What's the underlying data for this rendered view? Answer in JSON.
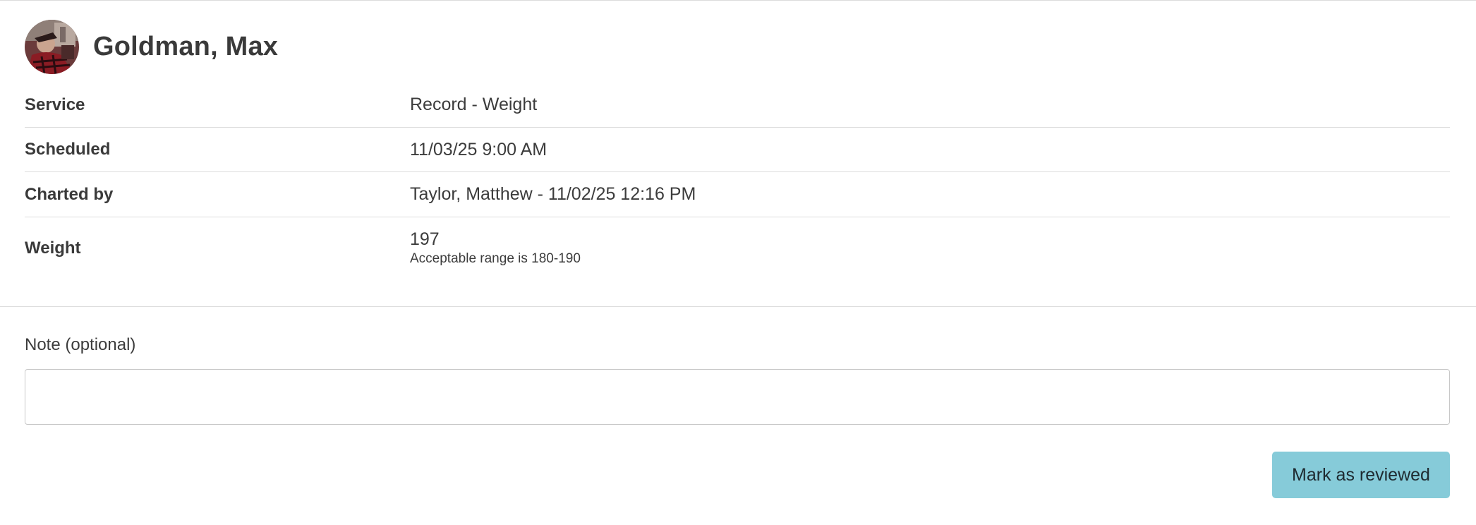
{
  "patient": {
    "name": "Goldman, Max",
    "avatar_icon": "patient-photo"
  },
  "details": [
    {
      "label": "Service",
      "value": "Record - Weight"
    },
    {
      "label": "Scheduled",
      "value": "11/03/25 9:00 AM"
    },
    {
      "label": "Charted by",
      "value": "Taylor, Matthew - 11/02/25 12:16 PM"
    },
    {
      "label": "Weight",
      "value": "197",
      "subtext": "Acceptable range is 180-190"
    }
  ],
  "note": {
    "label": "Note (optional)",
    "value": "",
    "placeholder": ""
  },
  "actions": {
    "mark_reviewed_label": "Mark as reviewed"
  },
  "colors": {
    "button_bg": "#86cbd9",
    "text": "#3c3c3c",
    "divider": "#dddddd"
  }
}
